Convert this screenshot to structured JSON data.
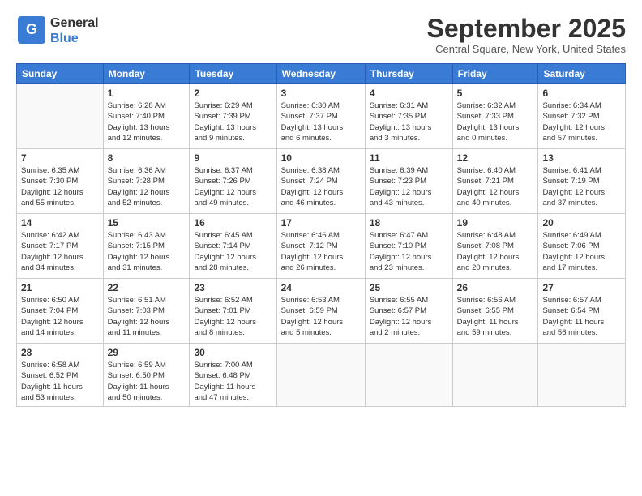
{
  "logo": {
    "text_general": "General",
    "text_blue": "Blue"
  },
  "header": {
    "month": "September 2025",
    "location": "Central Square, New York, United States"
  },
  "weekdays": [
    "Sunday",
    "Monday",
    "Tuesday",
    "Wednesday",
    "Thursday",
    "Friday",
    "Saturday"
  ],
  "weeks": [
    [
      {
        "num": "",
        "info": ""
      },
      {
        "num": "1",
        "info": "Sunrise: 6:28 AM\nSunset: 7:40 PM\nDaylight: 13 hours\nand 12 minutes."
      },
      {
        "num": "2",
        "info": "Sunrise: 6:29 AM\nSunset: 7:39 PM\nDaylight: 13 hours\nand 9 minutes."
      },
      {
        "num": "3",
        "info": "Sunrise: 6:30 AM\nSunset: 7:37 PM\nDaylight: 13 hours\nand 6 minutes."
      },
      {
        "num": "4",
        "info": "Sunrise: 6:31 AM\nSunset: 7:35 PM\nDaylight: 13 hours\nand 3 minutes."
      },
      {
        "num": "5",
        "info": "Sunrise: 6:32 AM\nSunset: 7:33 PM\nDaylight: 13 hours\nand 0 minutes."
      },
      {
        "num": "6",
        "info": "Sunrise: 6:34 AM\nSunset: 7:32 PM\nDaylight: 12 hours\nand 57 minutes."
      }
    ],
    [
      {
        "num": "7",
        "info": "Sunrise: 6:35 AM\nSunset: 7:30 PM\nDaylight: 12 hours\nand 55 minutes."
      },
      {
        "num": "8",
        "info": "Sunrise: 6:36 AM\nSunset: 7:28 PM\nDaylight: 12 hours\nand 52 minutes."
      },
      {
        "num": "9",
        "info": "Sunrise: 6:37 AM\nSunset: 7:26 PM\nDaylight: 12 hours\nand 49 minutes."
      },
      {
        "num": "10",
        "info": "Sunrise: 6:38 AM\nSunset: 7:24 PM\nDaylight: 12 hours\nand 46 minutes."
      },
      {
        "num": "11",
        "info": "Sunrise: 6:39 AM\nSunset: 7:23 PM\nDaylight: 12 hours\nand 43 minutes."
      },
      {
        "num": "12",
        "info": "Sunrise: 6:40 AM\nSunset: 7:21 PM\nDaylight: 12 hours\nand 40 minutes."
      },
      {
        "num": "13",
        "info": "Sunrise: 6:41 AM\nSunset: 7:19 PM\nDaylight: 12 hours\nand 37 minutes."
      }
    ],
    [
      {
        "num": "14",
        "info": "Sunrise: 6:42 AM\nSunset: 7:17 PM\nDaylight: 12 hours\nand 34 minutes."
      },
      {
        "num": "15",
        "info": "Sunrise: 6:43 AM\nSunset: 7:15 PM\nDaylight: 12 hours\nand 31 minutes."
      },
      {
        "num": "16",
        "info": "Sunrise: 6:45 AM\nSunset: 7:14 PM\nDaylight: 12 hours\nand 28 minutes."
      },
      {
        "num": "17",
        "info": "Sunrise: 6:46 AM\nSunset: 7:12 PM\nDaylight: 12 hours\nand 26 minutes."
      },
      {
        "num": "18",
        "info": "Sunrise: 6:47 AM\nSunset: 7:10 PM\nDaylight: 12 hours\nand 23 minutes."
      },
      {
        "num": "19",
        "info": "Sunrise: 6:48 AM\nSunset: 7:08 PM\nDaylight: 12 hours\nand 20 minutes."
      },
      {
        "num": "20",
        "info": "Sunrise: 6:49 AM\nSunset: 7:06 PM\nDaylight: 12 hours\nand 17 minutes."
      }
    ],
    [
      {
        "num": "21",
        "info": "Sunrise: 6:50 AM\nSunset: 7:04 PM\nDaylight: 12 hours\nand 14 minutes."
      },
      {
        "num": "22",
        "info": "Sunrise: 6:51 AM\nSunset: 7:03 PM\nDaylight: 12 hours\nand 11 minutes."
      },
      {
        "num": "23",
        "info": "Sunrise: 6:52 AM\nSunset: 7:01 PM\nDaylight: 12 hours\nand 8 minutes."
      },
      {
        "num": "24",
        "info": "Sunrise: 6:53 AM\nSunset: 6:59 PM\nDaylight: 12 hours\nand 5 minutes."
      },
      {
        "num": "25",
        "info": "Sunrise: 6:55 AM\nSunset: 6:57 PM\nDaylight: 12 hours\nand 2 minutes."
      },
      {
        "num": "26",
        "info": "Sunrise: 6:56 AM\nSunset: 6:55 PM\nDaylight: 11 hours\nand 59 minutes."
      },
      {
        "num": "27",
        "info": "Sunrise: 6:57 AM\nSunset: 6:54 PM\nDaylight: 11 hours\nand 56 minutes."
      }
    ],
    [
      {
        "num": "28",
        "info": "Sunrise: 6:58 AM\nSunset: 6:52 PM\nDaylight: 11 hours\nand 53 minutes."
      },
      {
        "num": "29",
        "info": "Sunrise: 6:59 AM\nSunset: 6:50 PM\nDaylight: 11 hours\nand 50 minutes."
      },
      {
        "num": "30",
        "info": "Sunrise: 7:00 AM\nSunset: 6:48 PM\nDaylight: 11 hours\nand 47 minutes."
      },
      {
        "num": "",
        "info": ""
      },
      {
        "num": "",
        "info": ""
      },
      {
        "num": "",
        "info": ""
      },
      {
        "num": "",
        "info": ""
      }
    ]
  ]
}
